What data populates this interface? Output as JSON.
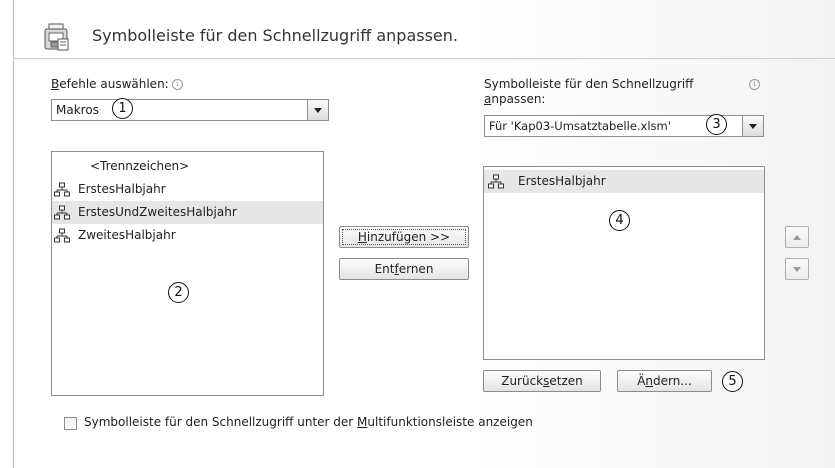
{
  "header": {
    "title": "Symbolleiste für den Schnellzugriff anpassen."
  },
  "left": {
    "label_prefix": "B",
    "label_rest": "efehle auswählen:",
    "combo_value": "Makros",
    "callout": "1",
    "list_callout": "2",
    "items": [
      {
        "label": "<Trennzeichen>",
        "icon": "none"
      },
      {
        "label": "ErstesHalbjahr",
        "icon": "macro-icon"
      },
      {
        "label": "ErstesUndZweitesHalbjahr",
        "icon": "macro-icon",
        "selected": true
      },
      {
        "label": "ZweitesHalbjahr",
        "icon": "macro-icon"
      }
    ]
  },
  "middle": {
    "add_pre": "",
    "add_u": "H",
    "add_post": "inzufügen >>",
    "remove_pre": "Ent",
    "remove_u": "f",
    "remove_post": "ernen"
  },
  "right": {
    "label_line1": "Symbolleiste für den Schnellzugriff",
    "label_line2_u": "a",
    "label_line2_rest": "npassen:",
    "combo_value": "Für 'Kap03-Umsatztabelle.xlsm'",
    "callout": "3",
    "list_callout": "4",
    "items": [
      {
        "label": "ErstesHalbjahr",
        "icon": "macro-icon",
        "selected": true
      }
    ],
    "reset_pre": "Zurück",
    "reset_u": "s",
    "reset_post": "etzen",
    "modify_pre": "Ä",
    "modify_u": "n",
    "modify_post": "dern...",
    "buttons_callout": "5"
  },
  "footer": {
    "checkbox_pre": "Symbolleiste für den Schnellzugriff unter der ",
    "checkbox_u": "M",
    "checkbox_post": "ultifunktionsleiste anzeigen",
    "checked": false
  },
  "icons": {
    "info": "i"
  }
}
